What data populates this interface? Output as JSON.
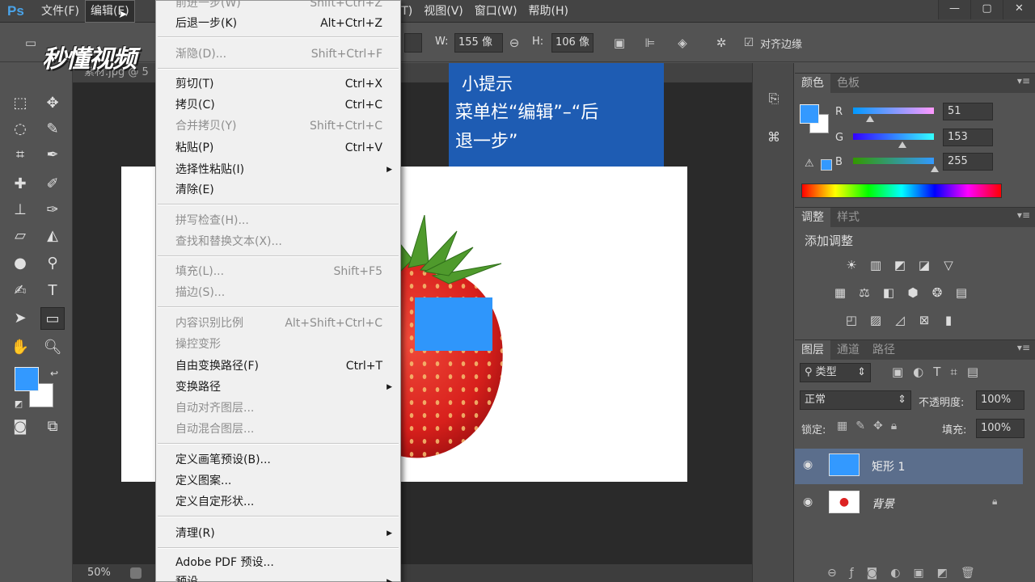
{
  "menubar": {
    "logo": "Ps",
    "items": [
      {
        "label": "文件(F)"
      },
      {
        "label": "编辑(E)"
      },
      {
        "label": "镜(T)"
      },
      {
        "label": "视图(V)"
      },
      {
        "label": "窗口(W)"
      },
      {
        "label": "帮助(H)"
      }
    ],
    "window_controls": [
      "—",
      "▢",
      "✕"
    ]
  },
  "options": {
    "w_label": "W:",
    "w_value": "155 像",
    "h_label": "H:",
    "h_value": "106 像",
    "align_edges": "对齐边缘"
  },
  "watermark": "秒懂视频",
  "document": {
    "tab_title": "素材.jpg @ 5",
    "zoom": "50%"
  },
  "tip": {
    "title": "小提示",
    "line1": "菜单栏“编辑”–“后",
    "line2": "退一步”"
  },
  "edit_menu": {
    "items": [
      {
        "label": "前进一步(W)",
        "shortcut": "Shift+Ctrl+Z",
        "disabled": true
      },
      {
        "label": "后退一步(K)",
        "shortcut": "Alt+Ctrl+Z"
      },
      {
        "label": "渐隐(D)...",
        "shortcut": "Shift+Ctrl+F",
        "disabled": true
      },
      {
        "label": "剪切(T)",
        "shortcut": "Ctrl+X"
      },
      {
        "label": "拷贝(C)",
        "shortcut": "Ctrl+C"
      },
      {
        "label": "合并拷贝(Y)",
        "shortcut": "Shift+Ctrl+C",
        "disabled": true
      },
      {
        "label": "粘贴(P)",
        "shortcut": "Ctrl+V"
      },
      {
        "label": "选择性粘贴(I)",
        "submenu": true
      },
      {
        "label": "清除(E)"
      },
      {
        "label": "拼写检查(H)...",
        "disabled": true
      },
      {
        "label": "查找和替换文本(X)...",
        "disabled": true
      },
      {
        "label": "填充(L)...",
        "shortcut": "Shift+F5",
        "disabled": true
      },
      {
        "label": "描边(S)...",
        "disabled": true
      },
      {
        "label": "内容识别比例",
        "shortcut": "Alt+Shift+Ctrl+C",
        "disabled": true
      },
      {
        "label": "操控变形",
        "disabled": true
      },
      {
        "label": "自由变换路径(F)",
        "shortcut": "Ctrl+T"
      },
      {
        "label": "变换路径",
        "submenu": true
      },
      {
        "label": "自动对齐图层...",
        "disabled": true
      },
      {
        "label": "自动混合图层...",
        "disabled": true
      },
      {
        "label": "定义画笔预设(B)..."
      },
      {
        "label": "定义图案..."
      },
      {
        "label": "定义自定形状..."
      },
      {
        "label": "清理(R)",
        "submenu": true
      },
      {
        "label": "Adobe PDF 预设..."
      },
      {
        "label": "预设",
        "submenu": true
      }
    ]
  },
  "color_panel": {
    "tabs": [
      "颜色",
      "色板"
    ],
    "r_label": "R",
    "r_value": "51",
    "g_label": "G",
    "g_value": "153",
    "b_label": "B",
    "b_value": "255",
    "fg_color": "#3399ff"
  },
  "adjust_panel": {
    "tabs": [
      "调整",
      "样式"
    ],
    "title": "添加调整"
  },
  "layers_panel": {
    "tabs": [
      "图层",
      "通道",
      "路径"
    ],
    "filter": "类型",
    "blend_mode": "正常",
    "opacity_label": "不透明度:",
    "opacity": "100%",
    "lock_label": "锁定:",
    "fill_label": "填充:",
    "fill": "100%",
    "layers": [
      {
        "name": "矩形 1"
      },
      {
        "name": "背景"
      }
    ]
  }
}
